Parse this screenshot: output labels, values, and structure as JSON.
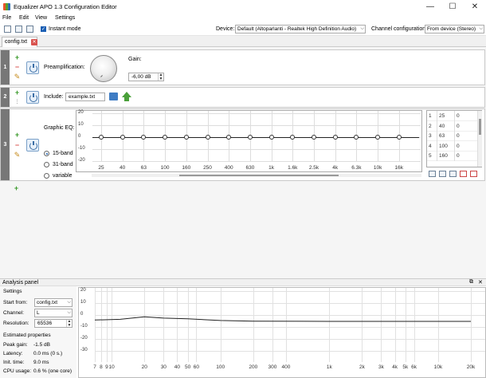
{
  "window": {
    "title": "Equalizer APO 1.3 Configuration Editor",
    "min": "—",
    "max": "☐",
    "close": "✕"
  },
  "menu": [
    "File",
    "Edit",
    "View",
    "Settings"
  ],
  "toolbar": {
    "instant_mode": "Instant mode",
    "device_label": "Device:",
    "device_value": "Default (Altoparlanti - Realtek High Definition Audio)",
    "channel_label": "Channel configuration:",
    "channel_value": "From device (Stereo)"
  },
  "tabs": [
    {
      "label": "config.txt"
    }
  ],
  "filters": {
    "p1": {
      "num": "1",
      "label": "Preamplification:",
      "gain_label": "Gain:",
      "gain_value": "-6,00 dB"
    },
    "p2": {
      "num": "2",
      "label": "Include:",
      "file": "example.txt"
    },
    "p3": {
      "num": "3",
      "label": "Graphic EQ:",
      "band_options": [
        "15-band",
        "31-band",
        "variable"
      ],
      "selected": 0,
      "y_ticks": [
        "20",
        "10",
        "0",
        "-10",
        "-20"
      ],
      "x_ticks": [
        "25",
        "40",
        "63",
        "100",
        "160",
        "250",
        "400",
        "630",
        "1k",
        "1.6k",
        "2.5k",
        "4k",
        "6.3k",
        "10k",
        "16k"
      ],
      "gains": [
        0,
        0,
        0,
        0,
        0,
        0,
        0,
        0,
        0,
        0,
        0,
        0,
        0,
        0,
        0
      ],
      "table": [
        [
          "1",
          "25",
          "0"
        ],
        [
          "2",
          "40",
          "0"
        ],
        [
          "3",
          "63",
          "0"
        ],
        [
          "4",
          "100",
          "0"
        ],
        [
          "5",
          "160",
          "0"
        ]
      ]
    }
  },
  "analysis": {
    "title": "Analysis panel",
    "settings_title": "Settings",
    "start_from_label": "Start from:",
    "start_from": "config.txt",
    "channel_label": "Channel:",
    "channel": "L",
    "resolution_label": "Resolution:",
    "resolution": "65536",
    "est_title": "Estimated properties",
    "peak_label": "Peak gain:",
    "peak": "-1.5 dB",
    "latency_label": "Latency:",
    "latency": "0.0 ms (0 s.)",
    "init_label": "Init. time:",
    "init": "9.0 ms",
    "cpu_label": "CPU usage:",
    "cpu": "0.6 % (one core)",
    "y_ticks": [
      "20",
      "10",
      "0",
      "-10",
      "-20",
      "-30"
    ],
    "x_ticks": [
      "7",
      "8",
      "9",
      "10",
      "20",
      "30",
      "40",
      "50",
      "60",
      "100",
      "200",
      "300",
      "400",
      "1k",
      "2k",
      "3k",
      "4k",
      "5k",
      "6k",
      "10k",
      "20k"
    ]
  }
}
